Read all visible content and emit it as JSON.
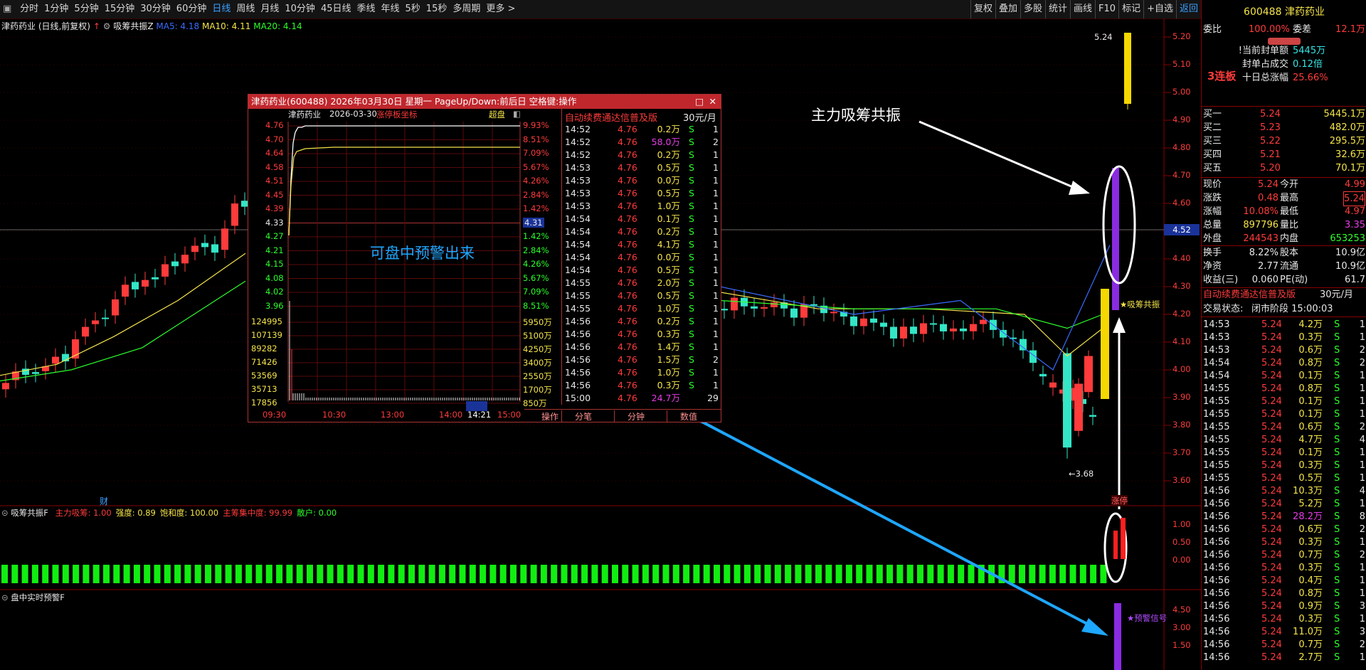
{
  "topbar": {
    "periods": [
      "分时",
      "1分钟",
      "5分钟",
      "15分钟",
      "30分钟",
      "60分钟",
      "日线",
      "周线",
      "月线",
      "10分钟",
      "45日线",
      "季线",
      "年线",
      "5秒",
      "15秒",
      "多周期",
      "更多 >"
    ],
    "active_period": "日线",
    "right_buttons": [
      "复权",
      "叠加",
      "多股",
      "统计",
      "画线",
      "F10",
      "标记",
      "+自选",
      "返回"
    ],
    "active_right": "返回"
  },
  "chart_header": {
    "stock_label": "津药药业 (日线,前复权)",
    "indicator": "吸筹共振Z",
    "ma5": "MA5: 4.18",
    "ma10": "MA10: 4.11",
    "ma20": "MA20: 4.14"
  },
  "price_axis": [
    "5.20",
    "5.10",
    "5.00",
    "4.90",
    "4.80",
    "4.70",
    "4.60",
    "4.50",
    "4.40",
    "4.30",
    "4.20",
    "4.10",
    "4.00",
    "3.90",
    "3.80",
    "3.70",
    "3.60"
  ],
  "crosshair_price": "4.52",
  "high_label": "5.24",
  "low_label": "3.68",
  "annotations": {
    "main_force": "主力吸筹共振",
    "warning": "可盘中预警出来",
    "xichou_tag": "★吸筹共振",
    "zhangting_tag": "涨停",
    "signal_tag": "★预警信号",
    "cai": "财"
  },
  "indicator1": {
    "name": "吸筹共振F",
    "items": [
      {
        "label": "主力吸筹: 1.00",
        "color": "#ff3b3b"
      },
      {
        "label": "强度: 0.89",
        "color": "#f5e44a"
      },
      {
        "label": "饱和度: 100.00",
        "color": "#f5e44a"
      },
      {
        "label": "主筹集中度: 99.99",
        "color": "#ff3b3b"
      },
      {
        "label": "散户: 0.00",
        "color": "#2cff2c"
      }
    ],
    "axis": [
      "1.00",
      "0.50",
      "0.00"
    ]
  },
  "indicator2": {
    "name": "盘中实时预警F",
    "axis": [
      "4.50",
      "3.00",
      "1.50"
    ]
  },
  "popup": {
    "title": "津药药业(600488) 2026年03月30日 星期一 PageUp/Down:前后日 空格键:操作",
    "sub_name": "津药药业",
    "sub_date": "2026-03-30",
    "sub_tag": "涨停板坐标",
    "sub_right": "超盘",
    "left_prices": [
      "4.76",
      "4.70",
      "4.64",
      "4.58",
      "4.51",
      "4.45",
      "4.39",
      "4.33",
      "4.27",
      "4.21",
      "4.15",
      "4.08",
      "4.02",
      "3.96"
    ],
    "right_pcts": [
      "9.93%",
      "8.51%",
      "7.09%",
      "5.67%",
      "4.26%",
      "2.84%",
      "1.42%",
      "4.31",
      "1.42%",
      "2.84%",
      "4.26%",
      "5.67%",
      "7.09%",
      "8.51%"
    ],
    "vol_left": [
      "124995",
      "107139",
      "89282",
      "71426",
      "53569",
      "35713",
      "17856"
    ],
    "vol_right": [
      "5950万",
      "5100万",
      "4250万",
      "3400万",
      "2550万",
      "1700万",
      "850万"
    ],
    "times": [
      "09:30",
      "10:30",
      "13:00",
      "14:00",
      "15:00"
    ],
    "cursor_time": "14:21",
    "right_header": "自动续费通达信普及版",
    "right_header_price": "30元/月",
    "ticks": [
      [
        "14:52",
        "4.76",
        "0.2万",
        "S",
        "1"
      ],
      [
        "14:52",
        "4.76",
        "58.0万",
        "S",
        "2"
      ],
      [
        "14:52",
        "4.76",
        "0.2万",
        "S",
        "1"
      ],
      [
        "14:53",
        "4.76",
        "0.5万",
        "S",
        "1"
      ],
      [
        "14:53",
        "4.76",
        "0.0万",
        "S",
        "1"
      ],
      [
        "14:53",
        "4.76",
        "0.5万",
        "S",
        "1"
      ],
      [
        "14:53",
        "4.76",
        "1.0万",
        "S",
        "1"
      ],
      [
        "14:54",
        "4.76",
        "0.1万",
        "S",
        "1"
      ],
      [
        "14:54",
        "4.76",
        "0.2万",
        "S",
        "1"
      ],
      [
        "14:54",
        "4.76",
        "4.1万",
        "S",
        "1"
      ],
      [
        "14:54",
        "4.76",
        "0.0万",
        "S",
        "1"
      ],
      [
        "14:54",
        "4.76",
        "0.5万",
        "S",
        "1"
      ],
      [
        "14:55",
        "4.76",
        "2.0万",
        "S",
        "1"
      ],
      [
        "14:55",
        "4.76",
        "0.5万",
        "S",
        "1"
      ],
      [
        "14:55",
        "4.76",
        "1.0万",
        "S",
        "1"
      ],
      [
        "14:56",
        "4.76",
        "0.2万",
        "S",
        "1"
      ],
      [
        "14:56",
        "4.76",
        "0.3万",
        "S",
        "1"
      ],
      [
        "14:56",
        "4.76",
        "1.4万",
        "S",
        "1"
      ],
      [
        "14:56",
        "4.76",
        "1.5万",
        "S",
        "2"
      ],
      [
        "14:56",
        "4.76",
        "1.0万",
        "S",
        "1"
      ],
      [
        "14:56",
        "4.76",
        "0.3万",
        "S",
        "1"
      ],
      [
        "15:00",
        "4.76",
        "24.7万",
        "",
        "29"
      ]
    ],
    "bottom_tabs": [
      "操作",
      "分笔",
      "分钟",
      "数值"
    ]
  },
  "quote": {
    "code_name": "600488 津药药业",
    "weibi_label": "委比",
    "weibi_val": "100.00%",
    "weicha_label": "委差",
    "weicha_val": "12.1万",
    "lianban": "3连板",
    "seal_info": [
      {
        "label": "!当前封单额",
        "val": "5445万"
      },
      {
        "label": "封单占成交",
        "val": "0.12倍"
      },
      {
        "label": "十日总涨幅",
        "val": "25.66%"
      }
    ],
    "bids": [
      {
        "label": "买一",
        "price": "5.24",
        "vol": "5445.1万"
      },
      {
        "label": "买二",
        "price": "5.23",
        "vol": "482.0万"
      },
      {
        "label": "买三",
        "price": "5.22",
        "vol": "295.5万"
      },
      {
        "label": "买四",
        "price": "5.21",
        "vol": "32.6万"
      },
      {
        "label": "买五",
        "price": "5.20",
        "vol": "70.1万"
      }
    ],
    "stats": [
      {
        "l1": "现价",
        "v1": "5.24",
        "l2": "今开",
        "v2": "4.99"
      },
      {
        "l1": "涨跌",
        "v1": "0.48",
        "l2": "最高",
        "v2": "5.24"
      },
      {
        "l1": "涨幅",
        "v1": "10.08%",
        "l2": "最低",
        "v2": "4.97"
      },
      {
        "l1": "总量",
        "v1": "897796",
        "l2": "量比",
        "v2": "3.35"
      },
      {
        "l1": "外盘",
        "v1": "244543",
        "l2": "内盘",
        "v2": "653253"
      }
    ],
    "stats2": [
      {
        "l1": "换手",
        "v1": "8.22%",
        "l2": "股本",
        "v2": "10.9亿"
      },
      {
        "l1": "净资",
        "v1": "2.77",
        "l2": "流通",
        "v2": "10.9亿"
      },
      {
        "l1": "收益(三)",
        "v1": "0.060",
        "l2": "PE(动)",
        "v2": "61.7"
      }
    ],
    "ad": "自动续费通达信普及版",
    "ad_price": "30元/月",
    "trade_state_label": "交易状态:",
    "trade_state": "闭市阶段 15:00:03",
    "ticks": [
      [
        "14:53",
        "5.24",
        "4.2万",
        "S",
        "1"
      ],
      [
        "14:53",
        "5.24",
        "0.3万",
        "S",
        "1"
      ],
      [
        "14:53",
        "5.24",
        "0.6万",
        "S",
        "2"
      ],
      [
        "14:54",
        "5.24",
        "0.8万",
        "S",
        "2"
      ],
      [
        "14:54",
        "5.24",
        "0.1万",
        "S",
        "1"
      ],
      [
        "14:55",
        "5.24",
        "0.8万",
        "S",
        "1"
      ],
      [
        "14:55",
        "5.24",
        "0.1万",
        "S",
        "1"
      ],
      [
        "14:55",
        "5.24",
        "0.1万",
        "S",
        "1"
      ],
      [
        "14:55",
        "5.24",
        "0.6万",
        "S",
        "2"
      ],
      [
        "14:55",
        "5.24",
        "4.7万",
        "S",
        "4"
      ],
      [
        "14:55",
        "5.24",
        "0.1万",
        "S",
        "1"
      ],
      [
        "14:55",
        "5.24",
        "0.3万",
        "S",
        "1"
      ],
      [
        "14:55",
        "5.24",
        "0.5万",
        "S",
        "1"
      ],
      [
        "14:56",
        "5.24",
        "10.3万",
        "S",
        "4"
      ],
      [
        "14:56",
        "5.24",
        "5.2万",
        "S",
        "1"
      ],
      [
        "14:56",
        "5.24",
        "28.2万",
        "S",
        "8"
      ],
      [
        "14:56",
        "5.24",
        "0.6万",
        "S",
        "2"
      ],
      [
        "14:56",
        "5.24",
        "0.3万",
        "S",
        "1"
      ],
      [
        "14:56",
        "5.24",
        "0.7万",
        "S",
        "2"
      ],
      [
        "14:56",
        "5.24",
        "0.3万",
        "S",
        "1"
      ],
      [
        "14:56",
        "5.24",
        "0.4万",
        "S",
        "1"
      ],
      [
        "14:56",
        "5.24",
        "0.8万",
        "S",
        "1"
      ],
      [
        "14:56",
        "5.24",
        "0.9万",
        "S",
        "3"
      ],
      [
        "14:56",
        "5.24",
        "0.3万",
        "S",
        "1"
      ],
      [
        "14:56",
        "5.24",
        "11.0万",
        "S",
        "3"
      ],
      [
        "14:56",
        "5.24",
        "0.7万",
        "S",
        "2"
      ],
      [
        "14:56",
        "5.24",
        "2.7万",
        "S",
        "1"
      ]
    ]
  },
  "colors": {
    "up": "#ff3b3b",
    "down": "#33e6c6",
    "ma5": "#e8e8e8",
    "ma10": "#f5e44a",
    "ma20": "#2cff2c",
    "accent": "#3aa0ff"
  }
}
